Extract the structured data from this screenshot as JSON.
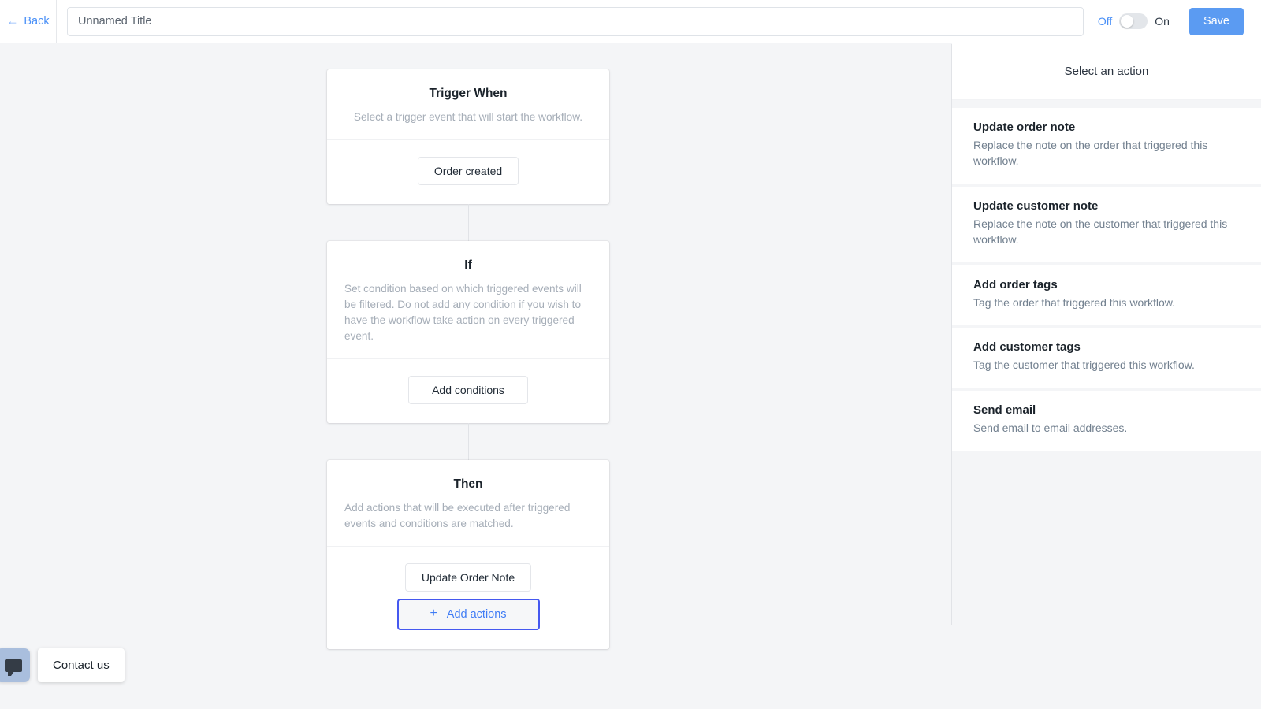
{
  "header": {
    "back_label": "Back",
    "back_icon": "arrow-left-icon",
    "title_value": "Unnamed Title",
    "title_placeholder": "Unnamed Title",
    "toggle_off_label": "Off",
    "toggle_on_label": "On",
    "toggle_state": "off",
    "save_label": "Save",
    "accent_color": "#5b9bf2",
    "link_color": "#4a90f7"
  },
  "flow": {
    "trigger": {
      "title": "Trigger When",
      "description": "Select a trigger event that will start the workflow.",
      "button_label": "Order created"
    },
    "condition": {
      "title": "If",
      "description": "Set condition based on which triggered events will be filtered. Do not add any condition if you wish to have the workflow take action on every triggered event.",
      "button_label": "Add conditions"
    },
    "action": {
      "title": "Then",
      "description": "Add actions that will be executed after triggered events and conditions are matched.",
      "selected_action_label": "Update Order Note",
      "add_actions_label": "Add actions",
      "add_actions_icon": "plus-icon",
      "add_actions_border_color": "#4558f0"
    }
  },
  "panel": {
    "title": "Select an action",
    "actions": [
      {
        "name": "Update order note",
        "description": "Replace the note on the order that triggered this workflow."
      },
      {
        "name": "Update customer note",
        "description": "Replace the note on the customer that triggered this workflow."
      },
      {
        "name": "Add order tags",
        "description": "Tag the order that triggered this workflow."
      },
      {
        "name": "Add customer tags",
        "description": "Tag the customer that triggered this workflow."
      },
      {
        "name": "Send email",
        "description": "Send email to email addresses."
      }
    ]
  },
  "contact": {
    "label": "Contact us",
    "icon": "chat-bubble-icon"
  }
}
